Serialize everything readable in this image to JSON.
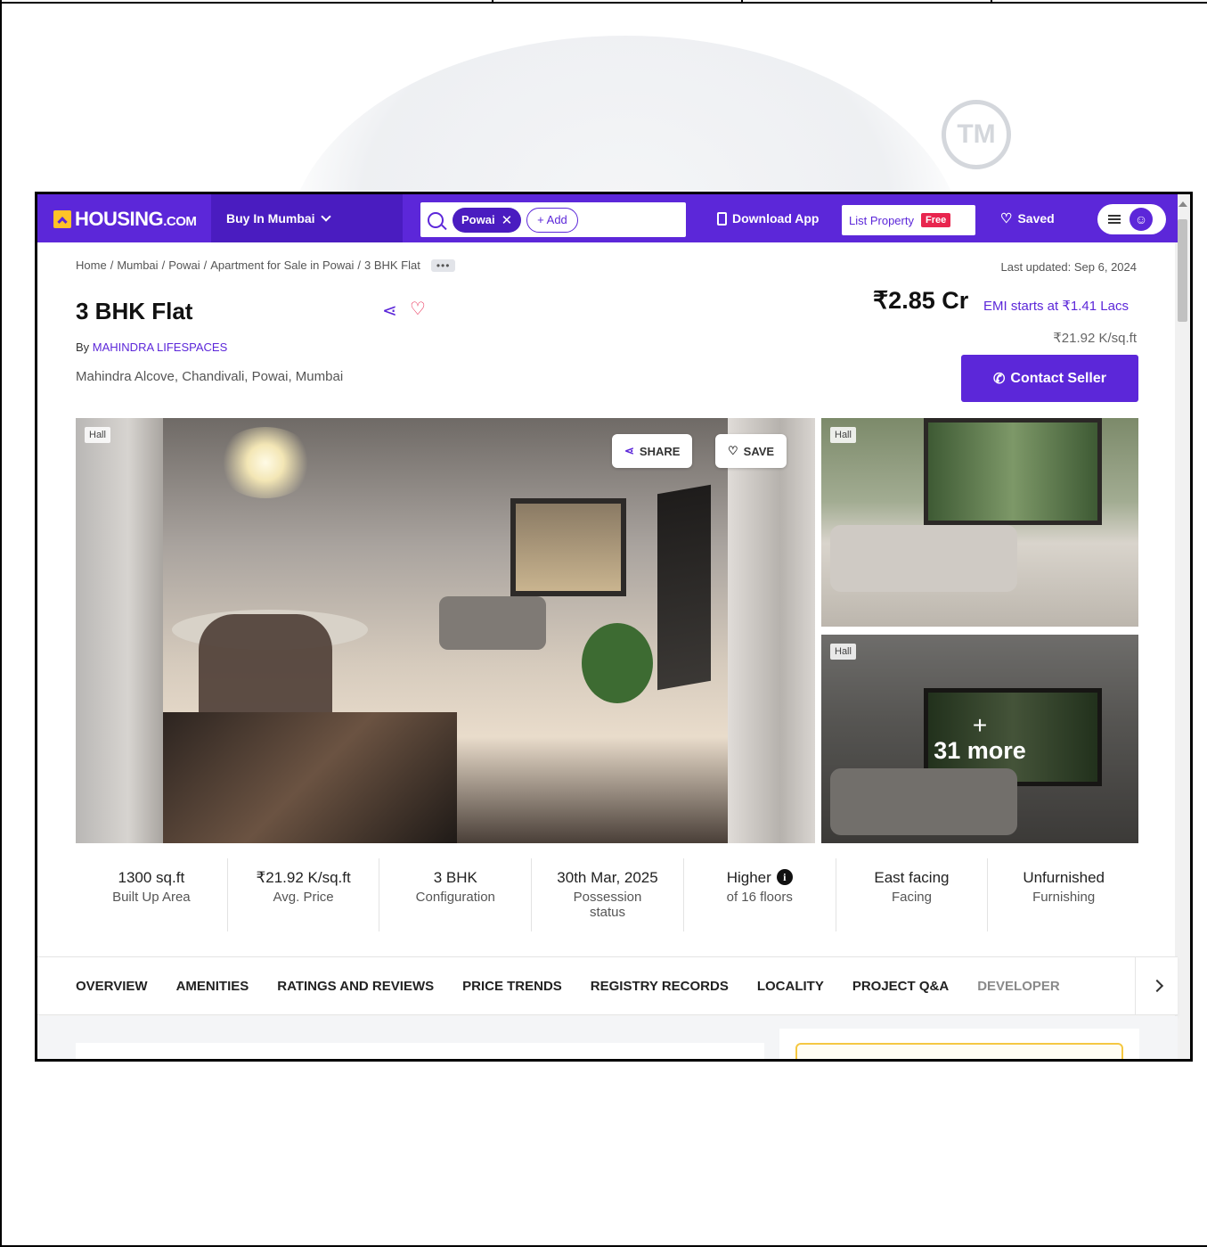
{
  "watermark": {
    "tm": "TM"
  },
  "nav": {
    "logo": "HOUSING",
    "logo_suffix": ".COM",
    "buy_menu": "Buy In Mumbai",
    "search_chip": "Powai",
    "search_chip_close": "✕",
    "add_chip": "+ Add",
    "download_app": "Download App",
    "list_property": "List Property",
    "free_badge": "Free",
    "saved": "Saved"
  },
  "breadcrumb": {
    "items": [
      "Home",
      "Mumbai",
      "Powai",
      "Apartment for Sale in Powai",
      "3 BHK Flat"
    ],
    "separator": "/",
    "more": "•••"
  },
  "last_updated": "Last updated: Sep 6, 2024",
  "listing": {
    "title": "3 BHK Flat",
    "by_prefix": "By",
    "developer": "MAHINDRA LIFESPACES",
    "address": "Mahindra Alcove, Chandivali, Powai, Mumbai",
    "price": "₹2.85 Cr",
    "emi": "EMI starts at ₹1.41 Lacs",
    "per_sqft": "₹21.92 K/sq.ft",
    "contact_button": "Contact Seller"
  },
  "gallery": {
    "main_tag": "Hall",
    "share": "SHARE",
    "save": "SAVE",
    "side_top_tag": "Hall",
    "side_bottom_tag": "Hall",
    "more_plus": "+",
    "more_text": "31 more"
  },
  "facts": [
    {
      "value": "1300 sq.ft",
      "label": "Built Up Area"
    },
    {
      "value": "₹21.92 K/sq.ft",
      "label": "Avg. Price"
    },
    {
      "value": "3 BHK",
      "label": "Configuration"
    },
    {
      "value": "30th Mar, 2025",
      "label": "Possession status"
    },
    {
      "value": "Higher",
      "label": "of 16 floors"
    },
    {
      "value": "East facing",
      "label": "Facing"
    },
    {
      "value": "Unfurnished",
      "label": "Furnishing"
    }
  ],
  "tabs": [
    "OVERVIEW",
    "AMENITIES",
    "RATINGS AND REVIEWS",
    "PRICE TRENDS",
    "REGISTRY RECORDS",
    "LOCALITY",
    "PROJECT Q&A",
    "DEVELOPER"
  ],
  "colors": {
    "brand": "#5c27d9",
    "brand_dark": "#4a1cc0",
    "logo_yellow": "#ffc328",
    "free_badge": "#e8254e"
  },
  "icons": [
    "search-icon",
    "close-icon",
    "phone-icon",
    "heart-icon",
    "menu-icon",
    "user-avatar-icon",
    "share-icon",
    "call-icon",
    "info-icon",
    "chevron-right-icon"
  ]
}
